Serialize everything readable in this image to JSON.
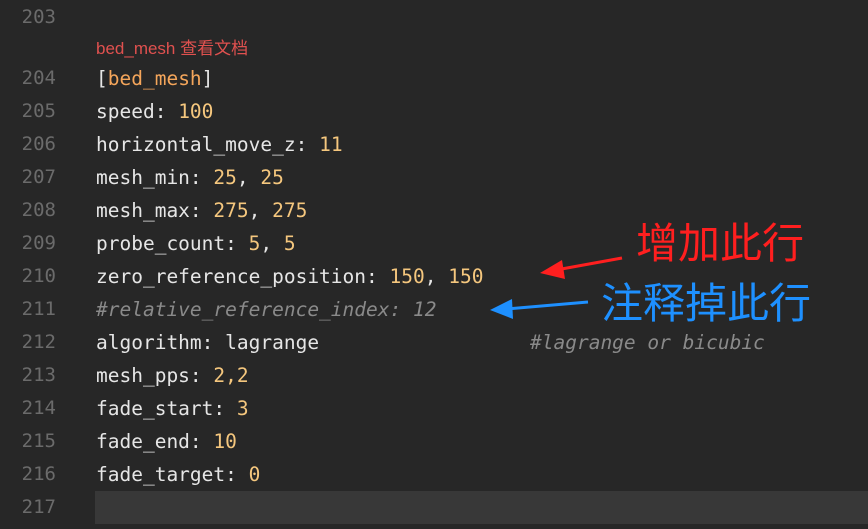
{
  "editor": {
    "codelens": {
      "section": "bed_mesh",
      "link_text": "查看文档"
    },
    "lines": [
      {
        "num": "203"
      },
      {
        "num": "204",
        "section_name": "bed_mesh"
      },
      {
        "num": "205",
        "key": "speed",
        "value": "100"
      },
      {
        "num": "206",
        "key": "horizontal_move_z",
        "value": "11"
      },
      {
        "num": "207",
        "key": "mesh_min",
        "value_a": "25",
        "value_b": "25"
      },
      {
        "num": "208",
        "key": "mesh_max",
        "value_a": "275",
        "value_b": "275"
      },
      {
        "num": "209",
        "key": "probe_count",
        "value_a": "5",
        "value_b": "5"
      },
      {
        "num": "210",
        "key": "zero_reference_position",
        "value_a": "150",
        "value_b": "150"
      },
      {
        "num": "211",
        "comment": "#relative_reference_index: 12"
      },
      {
        "num": "212",
        "key": "algorithm",
        "value": "lagrange",
        "trailing_comment": "#lagrange or bicubic"
      },
      {
        "num": "213",
        "key": "mesh_pps",
        "value": "2,2"
      },
      {
        "num": "214",
        "key": "fade_start",
        "value": "3"
      },
      {
        "num": "215",
        "key": "fade_end",
        "value": "10"
      },
      {
        "num": "216",
        "key": "fade_target",
        "value": "0"
      },
      {
        "num": "217"
      }
    ]
  },
  "annotations": {
    "add_line": {
      "text": "增加此行",
      "color": "#ff1f1f"
    },
    "comment_out": {
      "text": "注释掉此行",
      "color": "#1e90ff"
    }
  }
}
